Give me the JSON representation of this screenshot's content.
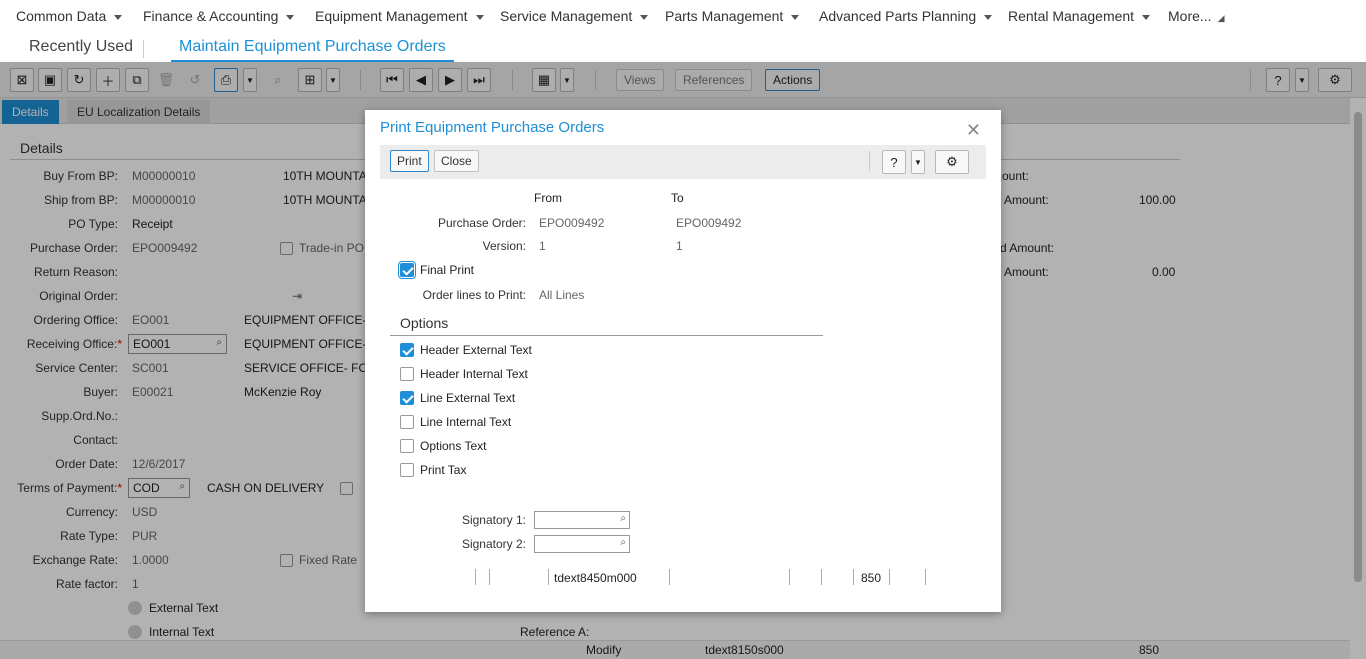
{
  "menu": [
    "Common Data",
    "Finance & Accounting",
    "Equipment Management",
    "Service Management",
    "Parts Management",
    "Advanced Parts Planning",
    "Rental Management"
  ],
  "menu_more": "More...",
  "tabs": {
    "recent": "Recently Used",
    "active": "Maintain Equipment Purchase Orders"
  },
  "toolbar": {
    "views": "Views",
    "references": "References",
    "actions": "Actions"
  },
  "subtabs": [
    "Details",
    "EU Localization Details"
  ],
  "section": "Details",
  "fields": {
    "buy_from_bp": {
      "label": "Buy From BP:",
      "value": "M00000010",
      "desc": "10TH MOUNTA"
    },
    "ship_from_bp": {
      "label": "Ship from BP:",
      "value": "M00000010",
      "desc": "10TH MOUNTA"
    },
    "po_type": {
      "label": "PO Type:",
      "value": "Receipt"
    },
    "purchase_order": {
      "label": "Purchase Order:",
      "value": "EPO009492",
      "trade_in": "Trade-in PO"
    },
    "return_reason": {
      "label": "Return Reason:"
    },
    "original_order": {
      "label": "Original Order:"
    },
    "ordering_office": {
      "label": "Ordering Office:",
      "value": "EO001",
      "desc": "EQUIPMENT OFFICE-"
    },
    "receiving_office": {
      "label": "Receiving Office:",
      "value": "EO001",
      "desc": "EQUIPMENT OFFICE-"
    },
    "service_center": {
      "label": "Service Center:",
      "value": "SC001",
      "desc": "SERVICE OFFICE- FO"
    },
    "buyer": {
      "label": "Buyer:",
      "value": "E00021",
      "desc": "McKenzie Roy"
    },
    "supp_ord_no": {
      "label": "Supp.Ord.No.:"
    },
    "contact": {
      "label": "Contact:"
    },
    "order_date": {
      "label": "Order Date:",
      "value": "12/6/2017"
    },
    "terms_of_payment": {
      "label": "Terms of Payment:",
      "value": "COD",
      "desc": "CASH ON DELIVERY"
    },
    "currency": {
      "label": "Currency:",
      "value": "USD"
    },
    "rate_type": {
      "label": "Rate Type:",
      "value": "PUR"
    },
    "exchange_rate": {
      "label": "Exchange Rate:",
      "value": "1.0000",
      "fixed": "Fixed Rate"
    },
    "rate_factor": {
      "label": "Rate factor:",
      "value": "1"
    },
    "external_text": "External Text",
    "internal_text": "Internal Text"
  },
  "right_fields": {
    "r1": "ount:",
    "r2": {
      "label": "Amount:",
      "value": "100.00"
    },
    "r3": "d Amount:",
    "r4": {
      "label": "Amount:",
      "value": "0.00"
    },
    "reference_a": "Reference A:"
  },
  "bottom": {
    "modify": "Modify",
    "code": "tdext8150s000",
    "num": "850"
  },
  "dialog": {
    "title": "Print Equipment Purchase Orders",
    "print": "Print",
    "close": "Close",
    "from": "From",
    "to": "To",
    "purchase_order_label": "Purchase Order:",
    "purchase_order_from": "EPO009492",
    "purchase_order_to": "EPO009492",
    "version_label": "Version:",
    "version_from": "1",
    "version_to": "1",
    "final_print": "Final Print",
    "order_lines_label": "Order lines to Print:",
    "order_lines_value": "All Lines",
    "options_title": "Options",
    "options": [
      {
        "label": "Header External Text",
        "checked": true
      },
      {
        "label": "Header Internal Text",
        "checked": false
      },
      {
        "label": "Line External Text",
        "checked": true
      },
      {
        "label": "Line Internal Text",
        "checked": false
      },
      {
        "label": "Options Text",
        "checked": false
      },
      {
        "label": "Print Tax",
        "checked": false
      }
    ],
    "signatory1": "Signatory 1:",
    "signatory2": "Signatory 2:",
    "status_code": "tdext8450m000",
    "status_num": "850"
  }
}
